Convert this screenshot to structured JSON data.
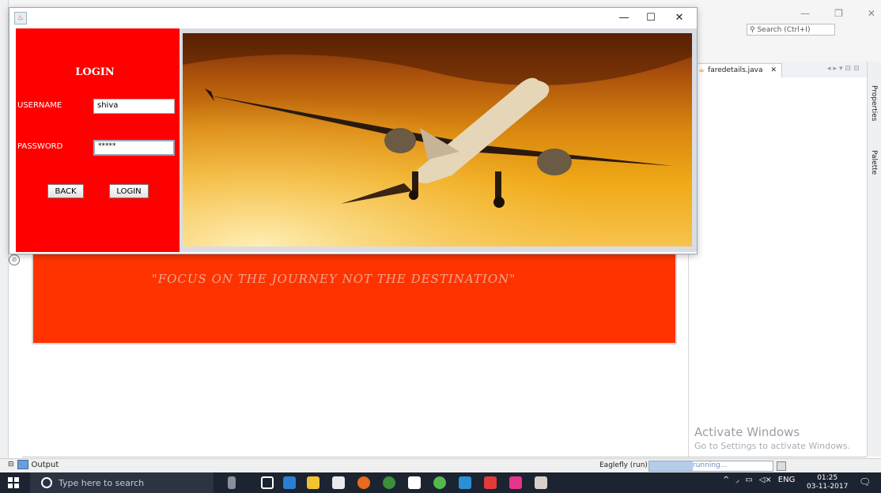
{
  "ide": {
    "search_placeholder": "Search (Ctrl+I)",
    "window_controls": [
      "—",
      "❐",
      "✕"
    ],
    "editor_tab": "faredetails.java",
    "side_panels": [
      "Properties",
      "Palette"
    ],
    "banner_quote": "\"FOCUS ON THE JOURNEY NOT THE DESTINATION\"",
    "activate_title": "Activate Windows",
    "activate_subtitle": "Go to Settings to activate Windows.",
    "output_tab": "Output",
    "run_label": "Eaglefly (run)",
    "run_status": "running...",
    "run_progress": 0.35
  },
  "login_window": {
    "controls": {
      "minimize": "—",
      "maximize": "☐",
      "close": "✕"
    },
    "title": "LOGIN",
    "username_label": "USERNAME",
    "username_value": "shiva",
    "password_label": "PASSWORD",
    "password_value": "*****",
    "back_button": "BACK",
    "login_button": "LOGIN"
  },
  "taskbar": {
    "search_placeholder": "Type here to search",
    "language": "ENG",
    "time": "01:25",
    "date": "03-11-2017",
    "notification_count": "2"
  },
  "colors": {
    "login_panel": "#ff0000",
    "banner": "#ff3300",
    "taskbar": "#1b2430"
  }
}
